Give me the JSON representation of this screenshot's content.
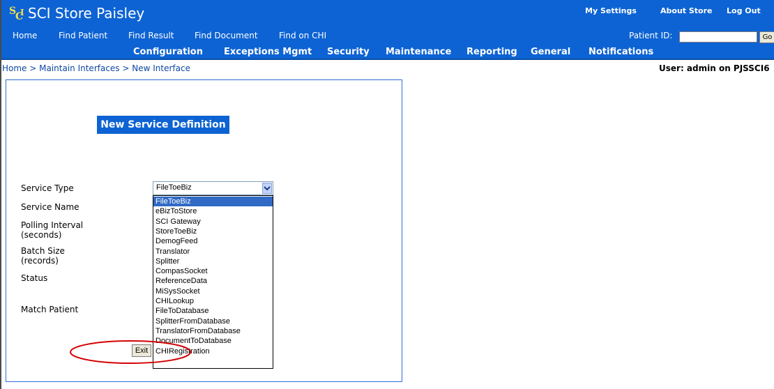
{
  "app": {
    "title": "SCI Store Paisley"
  },
  "top_links": [
    "My Settings",
    "About Store",
    "Log Out"
  ],
  "nav1": {
    "items": [
      "Home",
      "Find Patient",
      "Find Result",
      "Find Document",
      "Find on CHI"
    ],
    "patient_id_label": "Patient ID:",
    "patient_id_value": "",
    "go_label": "Go"
  },
  "nav2": {
    "items": [
      "Configuration",
      "Exceptions Mgmt",
      "Security",
      "Maintenance",
      "Reporting",
      "General",
      "Notifications"
    ]
  },
  "breadcrumb": "Home > Maintain Interfaces > New Interface",
  "user_info": "User: admin on PJSSCI6",
  "form": {
    "title": "New Service Definition",
    "labels": {
      "service_type": "Service Type",
      "service_name": "Service Name",
      "polling_1": "Polling Interval",
      "polling_2": "(seconds)",
      "batch_1": "Batch Size",
      "batch_2": "(records)",
      "status": "Status",
      "match_patient": "Match Patient"
    },
    "service_type_value": "FileToeBiz",
    "exit_label": "Exit"
  },
  "dropdown_options": [
    "FileToeBiz",
    "eBizToStore",
    "SCI Gateway",
    "StoreToeBiz",
    "DemogFeed",
    "Translator",
    "Splitter",
    "CompasSocket",
    "ReferenceData",
    "MiSysSocket",
    "CHILookup",
    "FileToDatabase",
    "SplitterFromDatabase",
    "TranslatorFromDatabase",
    "DocumentToDatabase",
    "CHIRegistration"
  ],
  "dropdown_selected_index": 0,
  "colors": {
    "brand": "#0d63d3",
    "selection": "#316ac5",
    "annotation": "#d40000"
  },
  "icons": [
    "sci-logo-icon",
    "chevron-down-icon"
  ]
}
